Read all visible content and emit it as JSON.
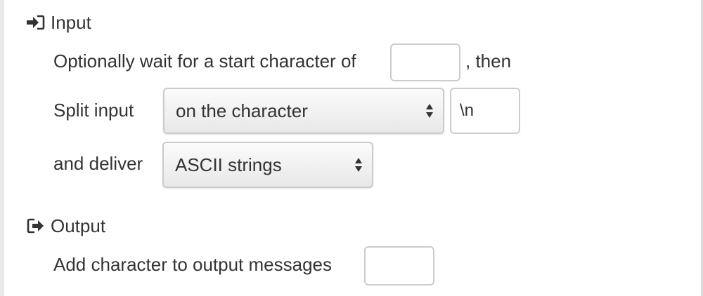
{
  "input_section": {
    "title": "Input",
    "icon": "sign-in-icon",
    "wait_label": "Optionally wait for a start character of",
    "wait_value": "",
    "then_label": ", then",
    "split_label": "Split input",
    "split_mode": "on the character",
    "split_char": "\\n",
    "deliver_label": "and deliver",
    "deliver_mode": "ASCII strings"
  },
  "output_section": {
    "title": "Output",
    "icon": "sign-out-icon",
    "add_char_label": "Add character to output messages",
    "add_char_value": ""
  }
}
